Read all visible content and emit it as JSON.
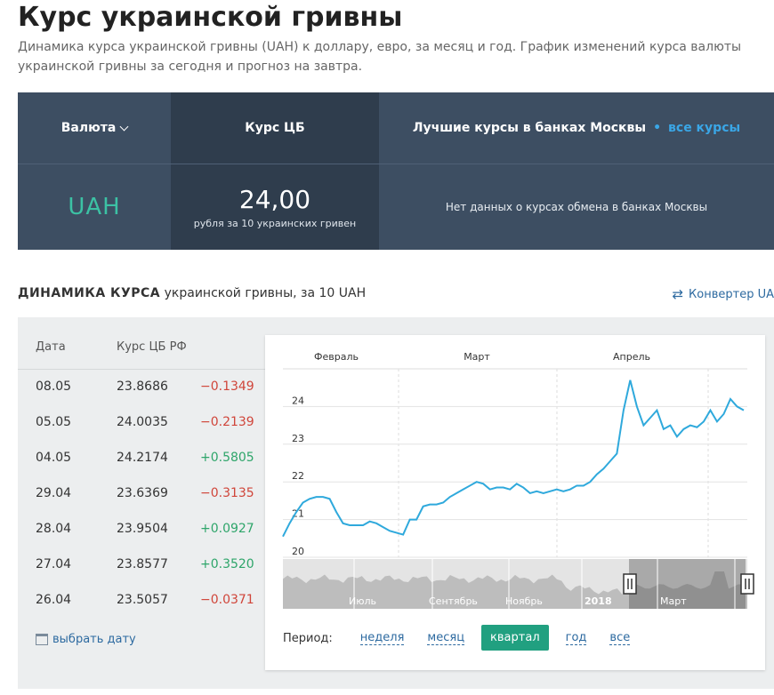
{
  "header": {
    "title": "Курс украинской гривны",
    "description": "Динамика курса украинской гривны (UAH) к доллару, евро, за месяц и год. График изменений курса валюты украинской гривны за сегодня и прогноз на завтра."
  },
  "rates_panel": {
    "currency_label": "Валюта",
    "cb_label": "Курс ЦБ",
    "best_label": "Лучшие курсы в банках Москвы",
    "all_rates_link": "все курсы",
    "currency_code": "UAH",
    "cb_value": "24,00",
    "cb_note": "рубля за 10 украинских гривен",
    "no_data": "Нет данных о курсах обмена в банках Москвы"
  },
  "dynamics": {
    "title_bold": "ДИНАМИКА КУРСА",
    "title_rest": "украинской гривны, за 10 UAH",
    "converter_link": "Конвертер UA",
    "col_date": "Дата",
    "col_rate": "Курс ЦБ РФ",
    "rows": [
      {
        "date": "08.05",
        "rate": "23.8686",
        "change": "−0.1349",
        "dir": "neg"
      },
      {
        "date": "05.05",
        "rate": "24.0035",
        "change": "−0.2139",
        "dir": "neg"
      },
      {
        "date": "04.05",
        "rate": "24.2174",
        "change": "+0.5805",
        "dir": "pos"
      },
      {
        "date": "29.04",
        "rate": "23.6369",
        "change": "−0.3135",
        "dir": "neg"
      },
      {
        "date": "28.04",
        "rate": "23.9504",
        "change": "+0.0927",
        "dir": "pos"
      },
      {
        "date": "27.04",
        "rate": "23.8577",
        "change": "+0.3520",
        "dir": "pos"
      },
      {
        "date": "26.04",
        "rate": "23.5057",
        "change": "−0.0371",
        "dir": "neg"
      }
    ],
    "pick_date": "выбрать дату"
  },
  "period": {
    "label": "Период:",
    "options": [
      "неделя",
      "месяц",
      "квартал",
      "год",
      "все"
    ],
    "active": "квартал"
  },
  "colors": {
    "line": "#2fa9dc",
    "active_period": "#21a080",
    "negative": "#d0453a",
    "positive": "#2ea56a"
  },
  "chart_data": {
    "type": "line",
    "month_labels": [
      "Февраль",
      "Март",
      "Апрель"
    ],
    "yticks": [
      20,
      21,
      22,
      23,
      24
    ],
    "ylim": [
      20,
      25
    ],
    "series": [
      {
        "values": [
          20.55,
          20.9,
          21.2,
          21.45,
          21.55,
          21.6,
          21.6,
          21.55,
          21.2,
          20.9,
          20.85,
          20.85,
          20.85,
          20.95,
          20.9,
          20.8,
          20.7,
          20.65,
          20.6,
          21.0,
          21.0,
          21.35,
          21.4,
          21.4,
          21.45,
          21.6,
          21.7,
          21.8,
          21.9,
          22.0,
          21.95,
          21.8,
          21.85,
          21.85,
          21.8,
          21.95,
          21.85,
          21.7,
          21.75,
          21.7,
          21.75,
          21.8,
          21.75,
          21.8,
          21.9,
          21.9,
          22.0,
          22.2,
          22.35,
          22.55,
          22.75,
          23.9,
          24.7,
          24.0,
          23.5,
          23.7,
          23.9,
          23.4,
          23.5,
          23.2,
          23.4,
          23.5,
          23.45,
          23.6,
          23.9,
          23.6,
          23.8,
          24.2,
          24.0,
          23.9
        ]
      }
    ],
    "navigator_labels": [
      "Июль",
      "Сентябрь",
      "Ноябрь",
      "2018",
      "Март"
    ]
  }
}
